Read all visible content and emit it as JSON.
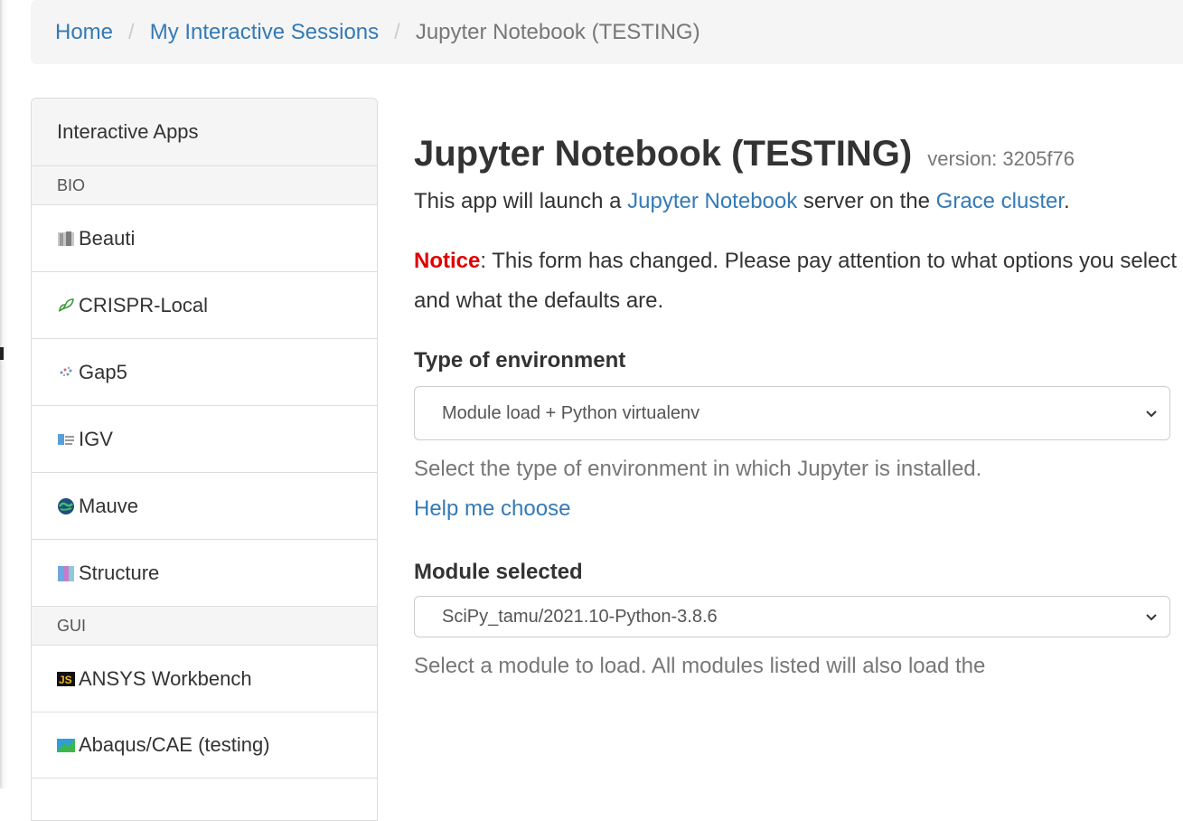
{
  "breadcrumb": {
    "home": "Home",
    "sessions": "My Interactive Sessions",
    "separator": "/",
    "current": "Jupyter Notebook (TESTING)"
  },
  "sidebar": {
    "heading": "Interactive Apps",
    "categories": {
      "bio": "BIO",
      "gui": "GUI"
    },
    "items": [
      {
        "label": "Beauti",
        "icon": "beauti-icon"
      },
      {
        "label": "CRISPR-Local",
        "icon": "crispr-icon"
      },
      {
        "label": "Gap5",
        "icon": "gap5-icon"
      },
      {
        "label": "IGV",
        "icon": "igv-icon"
      },
      {
        "label": "Mauve",
        "icon": "mauve-icon"
      },
      {
        "label": "Structure",
        "icon": "structure-icon"
      },
      {
        "label": "ANSYS Workbench",
        "icon": "ansys-icon"
      },
      {
        "label": "Abaqus/CAE (testing)",
        "icon": "abaqus-icon"
      }
    ]
  },
  "main": {
    "title": "Jupyter Notebook (TESTING)",
    "version": "version: 3205f76",
    "description": {
      "pre": "This app will launch a ",
      "link1": "Jupyter Notebook",
      "mid": " server on the ",
      "link2": "Grace cluster",
      "post": "."
    },
    "notice": {
      "label": "Notice",
      "text": ": This form has changed. Please pay attention to what options you select and what the defaults are."
    },
    "environment": {
      "label": "Type of environment",
      "selected": "Module load + Python virtualenv",
      "help": "Select the type of environment in which Jupyter is installed.",
      "help_link": "Help me choose"
    },
    "module": {
      "label": "Module selected",
      "selected": "SciPy_tamu/2021.10-Python-3.8.6",
      "help": "Select a module to load. All modules listed will also load the"
    }
  },
  "colors": {
    "link": "#337ab7",
    "notice": "#e00000",
    "muted": "#777777",
    "panel": "#f5f5f5"
  }
}
